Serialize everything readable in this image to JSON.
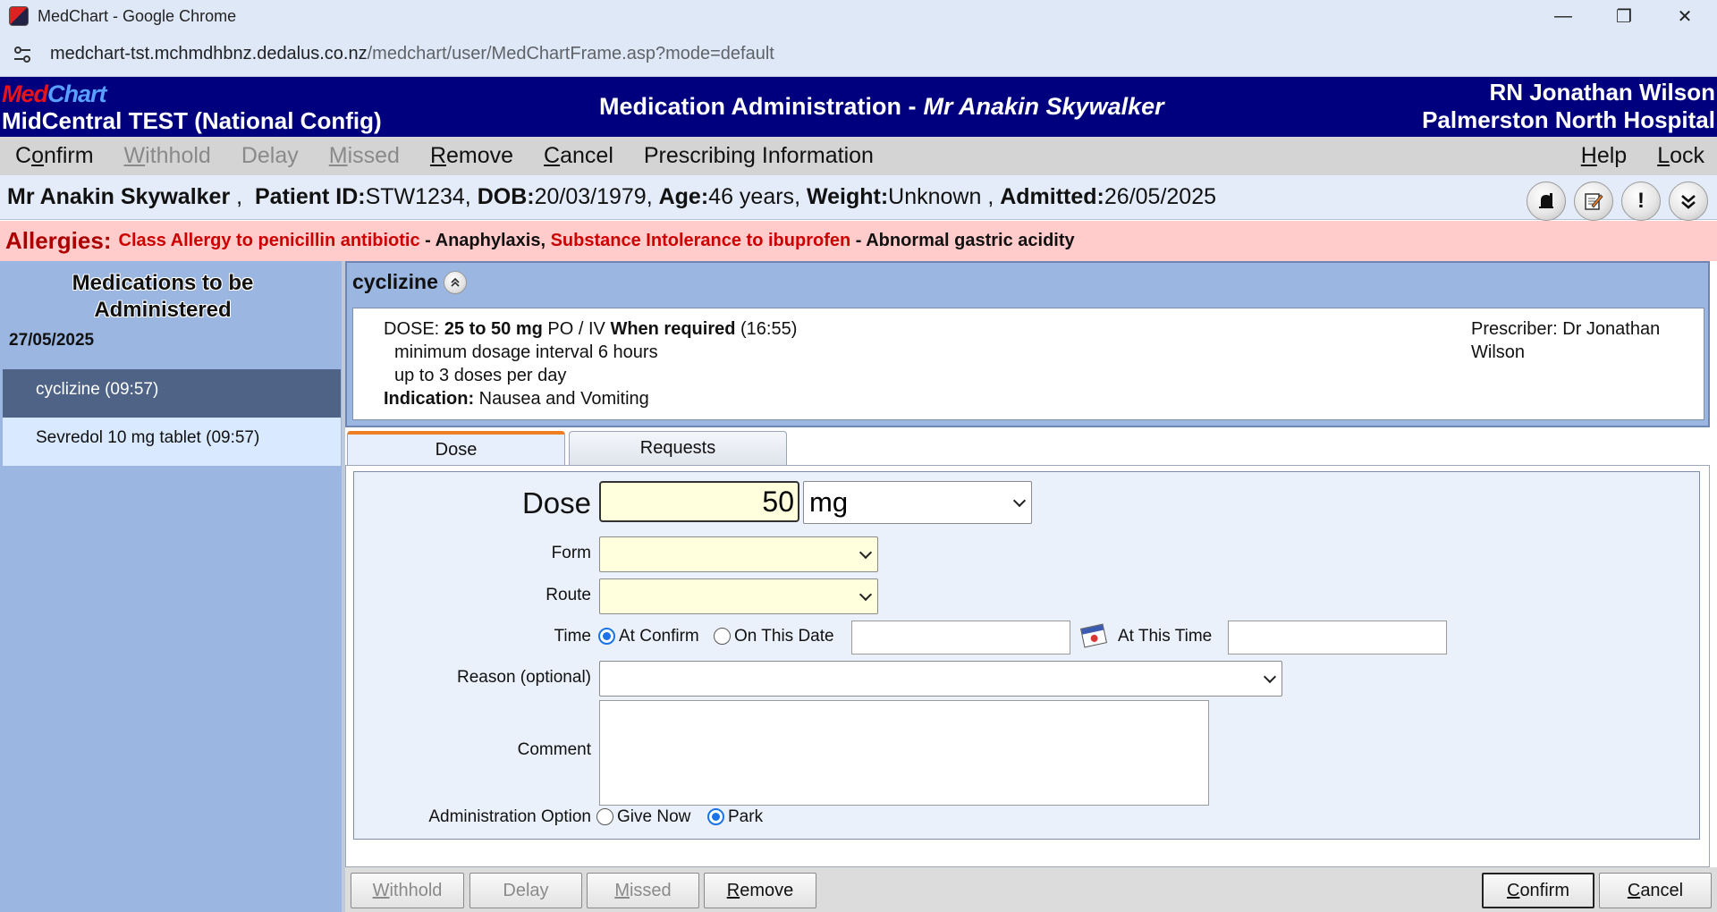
{
  "browser": {
    "window_title": "MedChart - Google Chrome",
    "url_host": "medchart-tst.mchmdhbnz.dedalus.co.nz",
    "url_path": "/medchart/user/MedChartFrame.asp?mode=default"
  },
  "header": {
    "logo_med": "Med",
    "logo_chart": "Chart",
    "org": "MidCentral TEST (National Config)",
    "screen_title": "Medication Administration -",
    "patient_name": "Mr Anakin Skywalker",
    "user": "RN Jonathan Wilson",
    "facility": "Palmerston North Hospital"
  },
  "menu": {
    "confirm_pre": "C",
    "confirm_u": "o",
    "confirm_post": "nfirm",
    "withhold_u": "W",
    "withhold_post": "ithhold",
    "delay": "Delay",
    "missed_u": "M",
    "missed_post": "issed",
    "remove_u": "R",
    "remove_post": "emove",
    "cancel_u": "C",
    "cancel_post": "ancel",
    "prescribing": "Prescribing Information",
    "help_u": "H",
    "help_post": "elp",
    "lock_u": "L",
    "lock_post": "ock"
  },
  "patient": {
    "name": "Mr Anakin Skywalker",
    "id_label": "Patient ID:",
    "id": "STW1234",
    "dob_label": "DOB:",
    "dob": "20/03/1979",
    "age_label": "Age:",
    "age": "46 years",
    "weight_label": "Weight:",
    "weight": "Unknown",
    "admitted_label": "Admitted:",
    "admitted": "26/05/2025"
  },
  "allergies": {
    "label": "Allergies:",
    "a1": "Class Allergy to penicillin antibiotic",
    "r1": " - Anaphylaxis",
    "a2": "Substance Intolerance to ibuprofen",
    "r2": " - Abnormal gastric acidity"
  },
  "left": {
    "title_line1": "Medications to be",
    "title_line2": "Administered",
    "date": "27/05/2025",
    "items": [
      {
        "label": "cyclizine (09:57)"
      },
      {
        "label": "Sevredol 10 mg tablet (09:57)"
      }
    ]
  },
  "med": {
    "name": "cyclizine",
    "dose_label": "DOSE:",
    "dose_value": "25 to 50 mg",
    "route": " PO / IV ",
    "frequency": "When required",
    "time": " (16:55)",
    "line2": "minimum dosage interval 6 hours",
    "line3": "up to 3 doses per day",
    "indication_label": "Indication:",
    "indication": " Nausea and Vomiting",
    "prescriber": "Prescriber: Dr Jonathan Wilson"
  },
  "tabs": {
    "dose": "Dose",
    "requests": "Requests"
  },
  "form": {
    "dose_label": "Dose",
    "dose_value": "50",
    "dose_unit": "mg",
    "form_label": "Form",
    "route_label": "Route",
    "time_label": "Time",
    "at_confirm": "At Confirm",
    "on_this_date": "On This Date",
    "at_this_time": "At This Time",
    "reason_label": "Reason (optional)",
    "comment_label": "Comment",
    "admin_option_label": "Administration Option",
    "give_now": "Give Now",
    "park": "Park"
  },
  "buttons": {
    "withhold_u": "W",
    "withhold_post": "ithhold",
    "delay": "Delay",
    "missed_u": "M",
    "missed_post": "issed",
    "remove_u": "R",
    "remove_post": "emove",
    "confirm_u": "C",
    "confirm_post": "onfirm",
    "cancel_u": "C",
    "cancel_post": "ancel"
  }
}
